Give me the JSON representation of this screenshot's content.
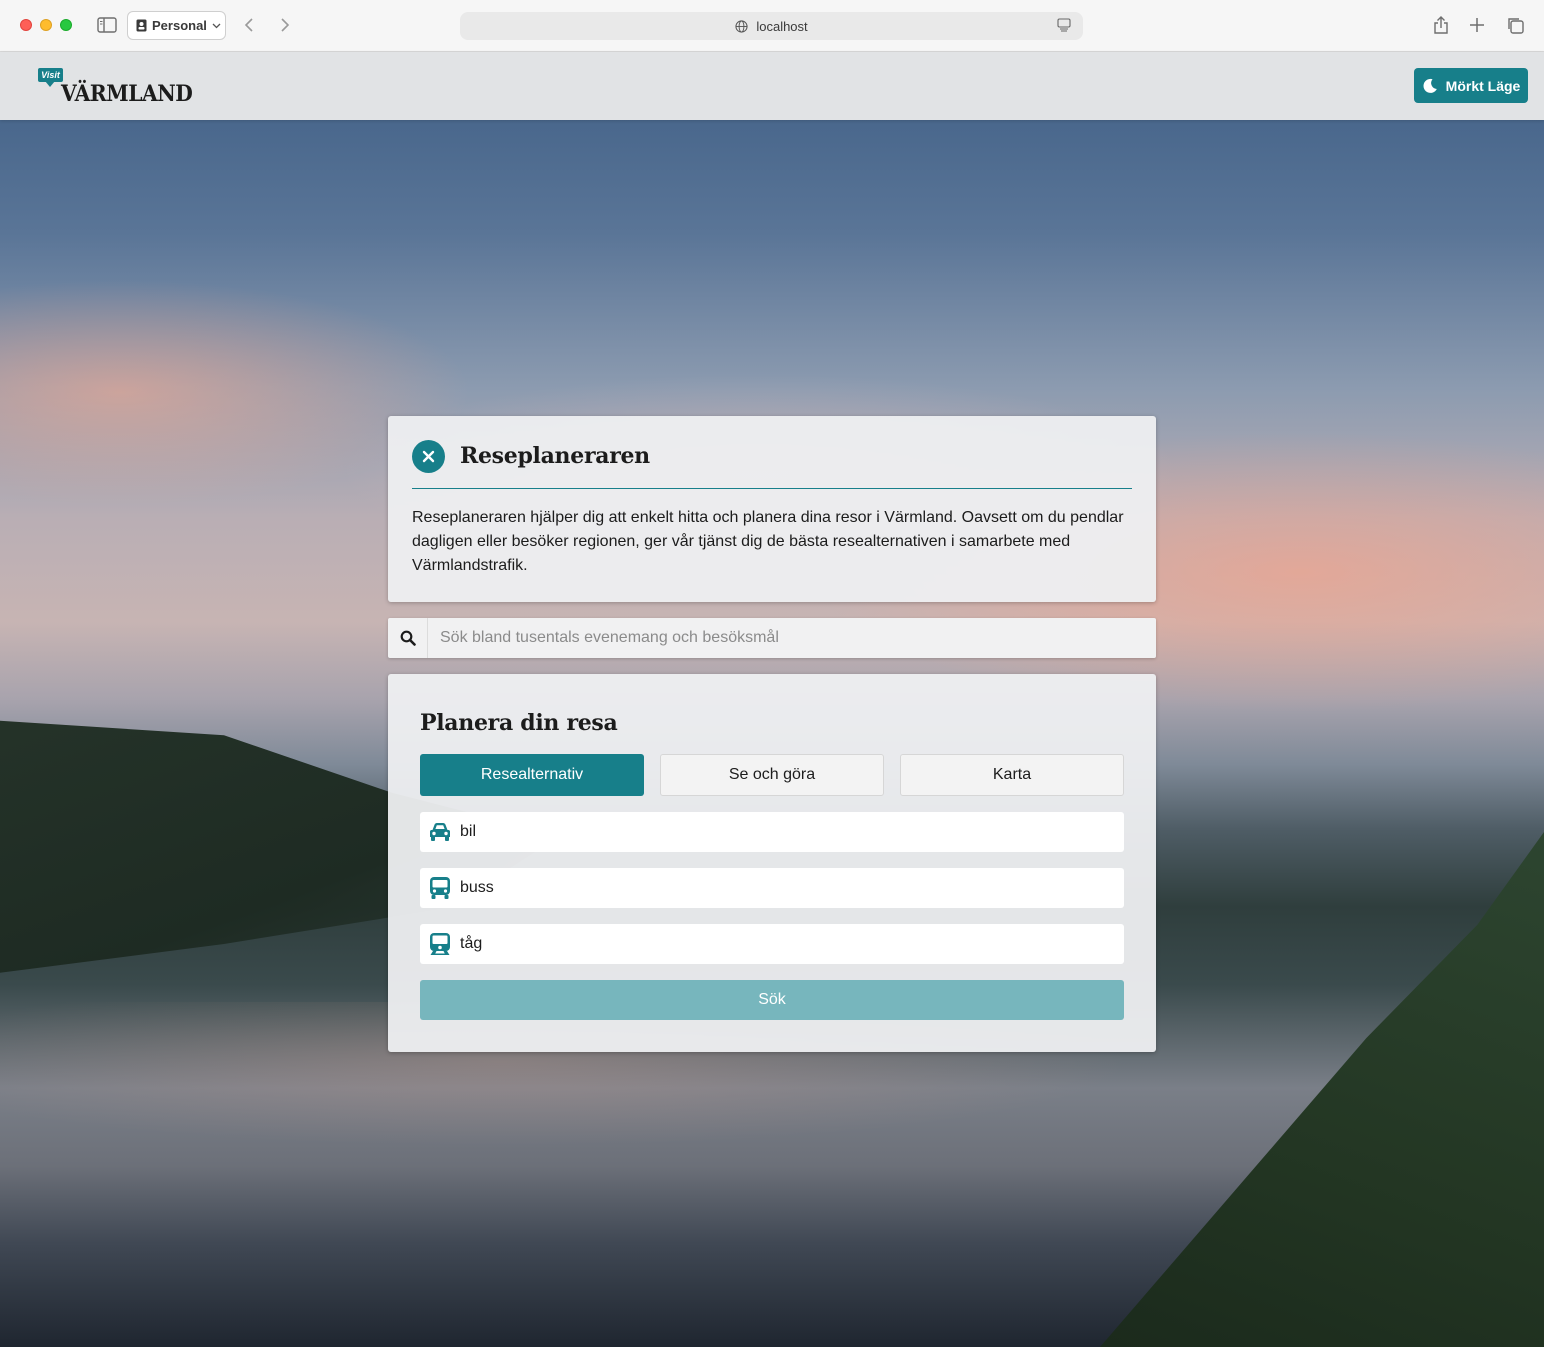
{
  "browser": {
    "profile_label": "Personal",
    "url": "localhost"
  },
  "header": {
    "logo_small": "Visit",
    "logo_main": "VÄRMLAND",
    "dark_mode_label": "Mörkt Läge"
  },
  "info": {
    "title": "Reseplaneraren",
    "text": "Reseplaneraren hjälper dig att enkelt hitta och planera dina resor i Värmland. Oavsett om du pendlar dagligen eller besöker regionen, ger vår tjänst dig de bästa resealternativen i samarbete med Värmlandstrafik."
  },
  "search": {
    "placeholder": "Sök bland tusentals evenemang och besöksmål"
  },
  "plan": {
    "title": "Planera din resa",
    "tabs": [
      {
        "label": "Resealternativ",
        "active": true
      },
      {
        "label": "Se och göra",
        "active": false
      },
      {
        "label": "Karta",
        "active": false
      }
    ],
    "options": [
      {
        "label": "bil",
        "icon": "car-icon"
      },
      {
        "label": "buss",
        "icon": "bus-icon"
      },
      {
        "label": "tåg",
        "icon": "train-icon"
      }
    ],
    "submit_label": "Sök"
  },
  "colors": {
    "accent": "#177f8a",
    "accent_disabled": "#77b6bd"
  }
}
